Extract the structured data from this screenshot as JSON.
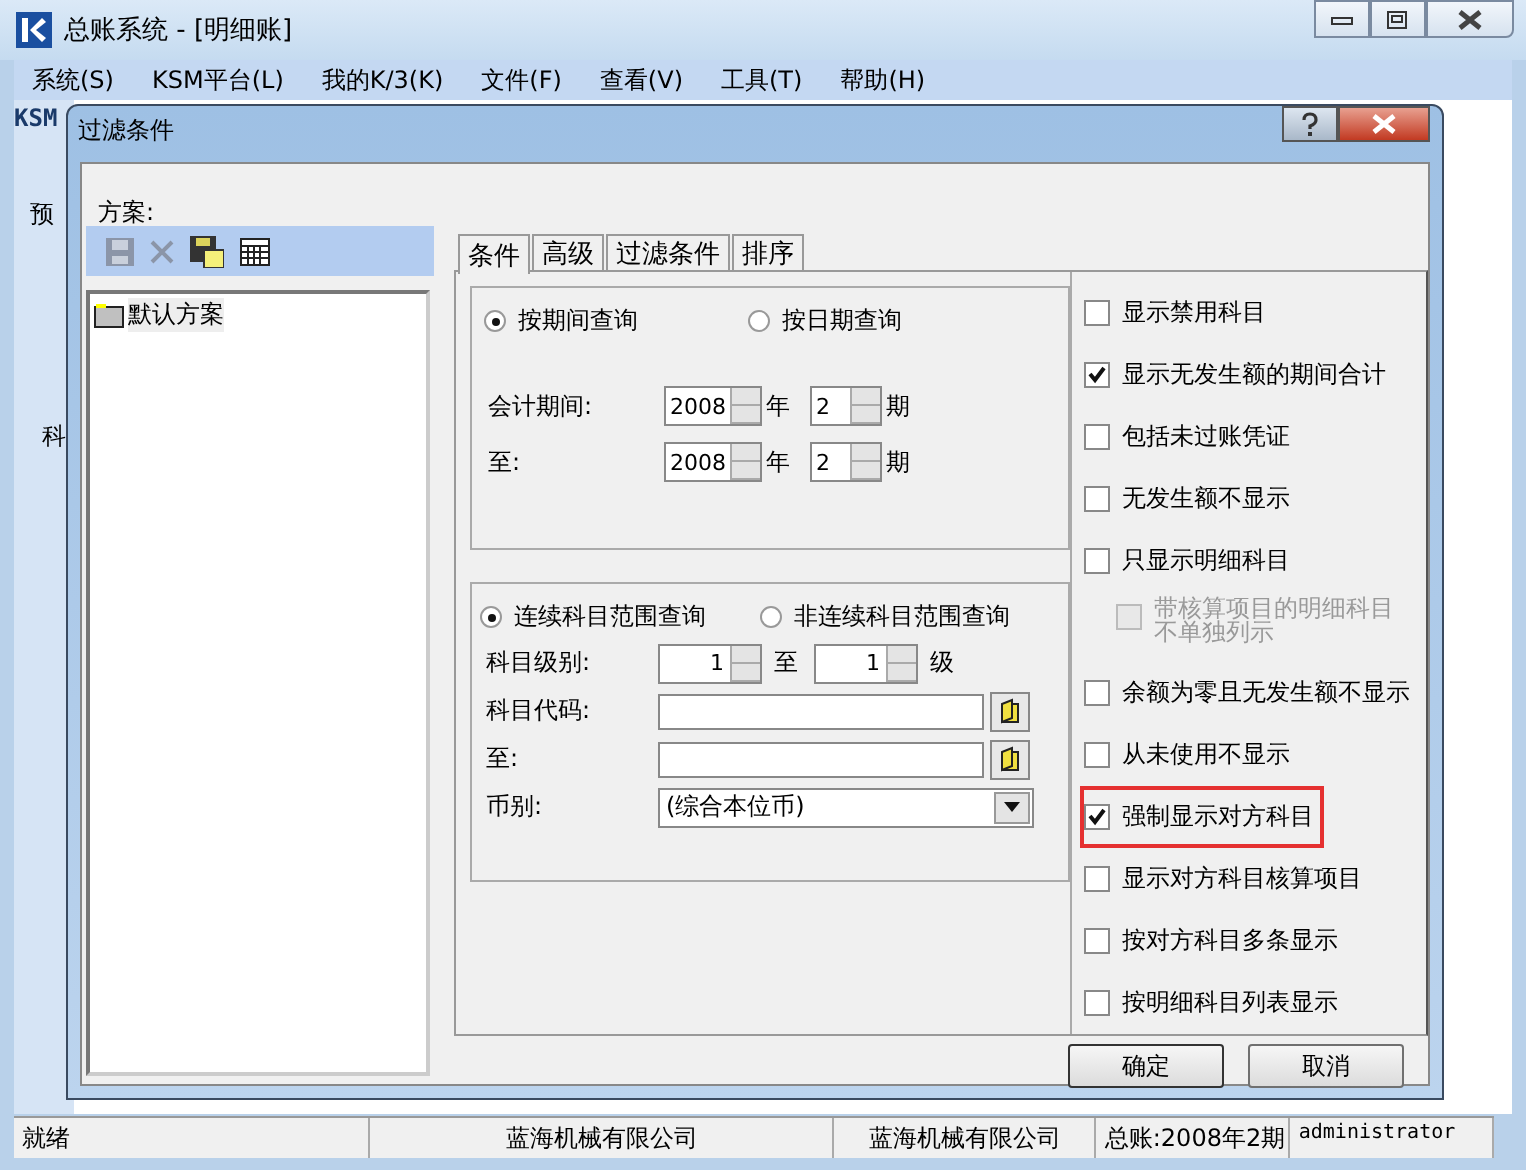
{
  "window": {
    "title": "总账系统 - [明细账]"
  },
  "menu": [
    "系统(S)",
    "KSM平台(L)",
    "我的K/3(K)",
    "文件(F)",
    "查看(V)",
    "工具(T)",
    "帮助(H)"
  ],
  "background_labels": [
    "KSM",
    "预",
    "科"
  ],
  "dialog": {
    "title": "过滤条件",
    "plan_label": "方案:",
    "plans": [
      {
        "label": "默认方案",
        "selected": true
      }
    ],
    "tabs": [
      {
        "label": "条件",
        "selected": true
      },
      {
        "label": "高级",
        "selected": false
      },
      {
        "label": "过滤条件",
        "selected": false
      },
      {
        "label": "排序",
        "selected": false
      }
    ],
    "query_modes": [
      {
        "label": "按期间查询",
        "selected": true
      },
      {
        "label": "按日期查询",
        "selected": false
      }
    ],
    "period_rows": [
      {
        "label": "会计期间:",
        "year": "2008",
        "year_unit": "年",
        "period": "2",
        "period_unit": "期"
      },
      {
        "label": "至:",
        "year": "2008",
        "year_unit": "年",
        "period": "2",
        "period_unit": "期"
      }
    ],
    "range_modes": [
      {
        "label": "连续科目范围查询",
        "selected": true
      },
      {
        "label": "非连续科目范围查询",
        "selected": false
      }
    ],
    "level": {
      "label": "科目级别:",
      "from": "1",
      "to_label": "至",
      "to": "1",
      "unit": "级"
    },
    "code_from": {
      "label": "科目代码:"
    },
    "code_to": {
      "label": "至:"
    },
    "currency": {
      "label": "币别:",
      "value": "(综合本位币)"
    },
    "options": [
      {
        "label": "显示禁用科目",
        "checked": false,
        "disabled": false,
        "indented": false,
        "highlighted": false
      },
      {
        "label": "显示无发生额的期间合计",
        "checked": true,
        "disabled": false,
        "indented": false,
        "highlighted": false
      },
      {
        "label": "包括未过账凭证",
        "checked": false,
        "disabled": false,
        "indented": false,
        "highlighted": false
      },
      {
        "label": "无发生额不显示",
        "checked": false,
        "disabled": false,
        "indented": false,
        "highlighted": false
      },
      {
        "label": "只显示明细科目",
        "checked": false,
        "disabled": false,
        "indented": false,
        "highlighted": false
      },
      {
        "label": "带核算项目的明细科目不单独列示",
        "checked": false,
        "disabled": true,
        "indented": true,
        "highlighted": false
      },
      {
        "label": "余额为零且无发生额不显示",
        "checked": false,
        "disabled": false,
        "indented": false,
        "highlighted": false
      },
      {
        "label": "从未使用不显示",
        "checked": false,
        "disabled": false,
        "indented": false,
        "highlighted": false
      },
      {
        "label": "强制显示对方科目",
        "checked": true,
        "disabled": false,
        "indented": false,
        "highlighted": true
      },
      {
        "label": "显示对方科目核算项目",
        "checked": false,
        "disabled": false,
        "indented": false,
        "highlighted": false
      },
      {
        "label": "按对方科目多条显示",
        "checked": false,
        "disabled": false,
        "indented": false,
        "highlighted": false
      },
      {
        "label": "按明细科目列表显示",
        "checked": false,
        "disabled": false,
        "indented": false,
        "highlighted": false
      }
    ],
    "buttons": [
      "确定",
      "取消"
    ]
  },
  "status_bar": [
    "就绪",
    "蓝海机械有限公司",
    "蓝海机械有限公司",
    "总账:2008年2期",
    "administrator"
  ]
}
